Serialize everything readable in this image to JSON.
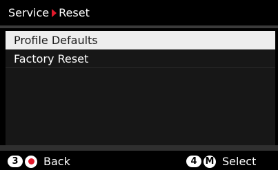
{
  "header": {
    "breadcrumb_parent": "Service",
    "breadcrumb_current": "Reset"
  },
  "menu": {
    "items": [
      {
        "label": "Profile Defaults",
        "selected": true
      },
      {
        "label": "Factory Reset",
        "selected": false
      }
    ]
  },
  "footer": {
    "back": {
      "key": "3",
      "label": "Back"
    },
    "select": {
      "key": "4",
      "key2": "M",
      "label": "Select"
    }
  },
  "colors": {
    "accent": "#e1192b",
    "selection_bg": "#ededed",
    "panel_bg": "#171717",
    "background": "#000000"
  }
}
